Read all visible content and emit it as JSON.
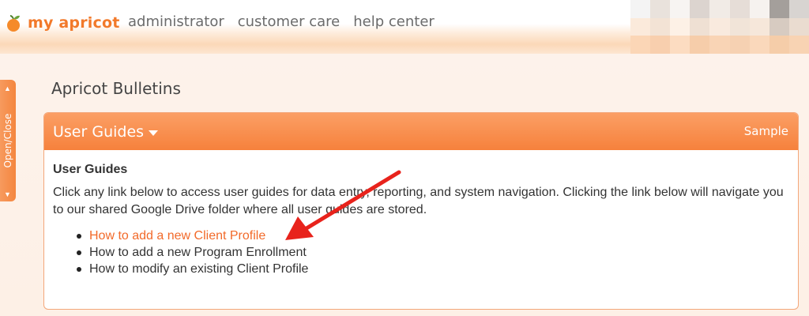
{
  "header": {
    "brand": "my apricot",
    "nav": [
      "administrator",
      "customer care",
      "help center"
    ],
    "avatar_colors": [
      "#f4f4f4",
      "#e9e2dc",
      "#f7f4f2",
      "#dcd4cf",
      "#f1ebe6",
      "#e6ddd7",
      "#f6f2ef",
      "#a49f9b",
      "#d8d4d1",
      "#fbeadb",
      "#f3e3d5",
      "#fdf1e6",
      "#efe0d3",
      "#f9eade",
      "#f1e4d8",
      "#f6e7da",
      "#d7cbc1",
      "#eadcd0",
      "#fbd6b6",
      "#f8cfae",
      "#fcdcc1",
      "#f6cdaa",
      "#f9d4b5",
      "#f6d1b2",
      "#fad8bb",
      "#f5cda9",
      "#f8d3b3"
    ]
  },
  "side_tab": {
    "label": "Open/Close"
  },
  "page_title": "Apricot Bulletins",
  "panel": {
    "title": "User Guides",
    "right_label": "Sample",
    "heading": "User Guides",
    "description": "Click any link below to access user guides for data entry, reporting, and system navigation.  Clicking the link below will navigate you to our shared Google Drive folder where all user guides are stored.",
    "items": [
      "How to add a new Client Profile",
      "How to add a new Program Enrollment",
      "How to modify an existing Client Profile"
    ]
  },
  "colors": {
    "accent": "#f6813c",
    "link": "#f26a2a",
    "annotation_arrow": "#e8231c"
  }
}
